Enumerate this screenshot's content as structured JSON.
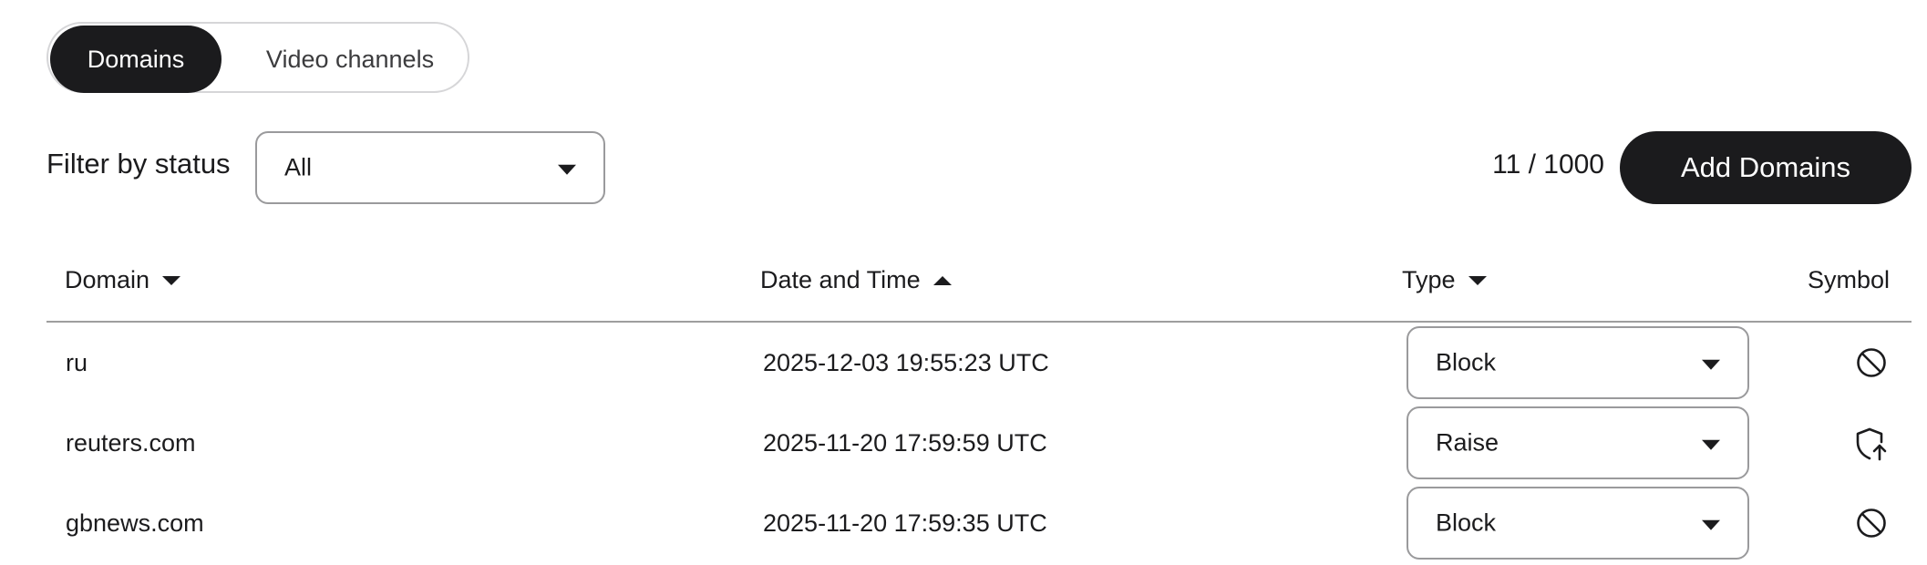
{
  "tabs": [
    {
      "label": "Domains",
      "active": true
    },
    {
      "label": "Video channels",
      "active": false
    }
  ],
  "filter": {
    "label": "Filter by status",
    "value": "All"
  },
  "quota": {
    "text": "11 / 1000"
  },
  "add_button": {
    "label": "Add Domains"
  },
  "table": {
    "headers": {
      "domain": "Domain",
      "datetime": "Date and Time",
      "type": "Type",
      "symbol": "Symbol"
    },
    "rows": [
      {
        "domain": "ru",
        "datetime": "2025-12-03 19:55:23 UTC",
        "type": "Block",
        "symbol": "block-icon"
      },
      {
        "domain": "reuters.com",
        "datetime": "2025-11-20 17:59:59 UTC",
        "type": "Raise",
        "symbol": "shield-raise-icon"
      },
      {
        "domain": "gbnews.com",
        "datetime": "2025-11-20 17:59:35 UTC",
        "type": "Block",
        "symbol": "block-icon"
      }
    ]
  },
  "colors": {
    "primary": "#1b1b1d",
    "border": "#9a9a9c",
    "tab_border": "#d6d6d8"
  }
}
